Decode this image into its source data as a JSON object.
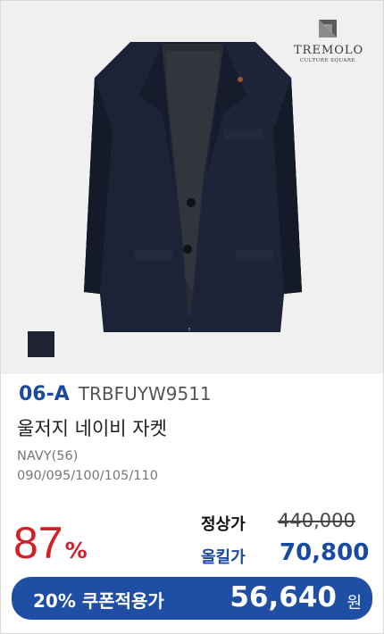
{
  "brand": {
    "name": "TREMOLO",
    "tagline": "CULTURE SQUARE"
  },
  "product": {
    "code_prefix": "06-A",
    "sku": "TRBFUYW9511",
    "name": "울저지 네이비 자켓",
    "color": "NAVY(56)",
    "sizes": "090/095/100/105/110",
    "swatch_color": "#1e2233"
  },
  "pricing": {
    "discount_value": "87",
    "discount_unit": "%",
    "regular_label": "정상가",
    "regular_price": "440,000",
    "sale_label": "올킬가",
    "sale_price": "70,800"
  },
  "coupon": {
    "label": "20% 쿠폰적용가",
    "price": "56,640",
    "unit": "원"
  },
  "colors": {
    "accent_blue": "#1a4aa0",
    "discount_red": "#d0212b",
    "coupon_bar": "#1f4ea5"
  }
}
